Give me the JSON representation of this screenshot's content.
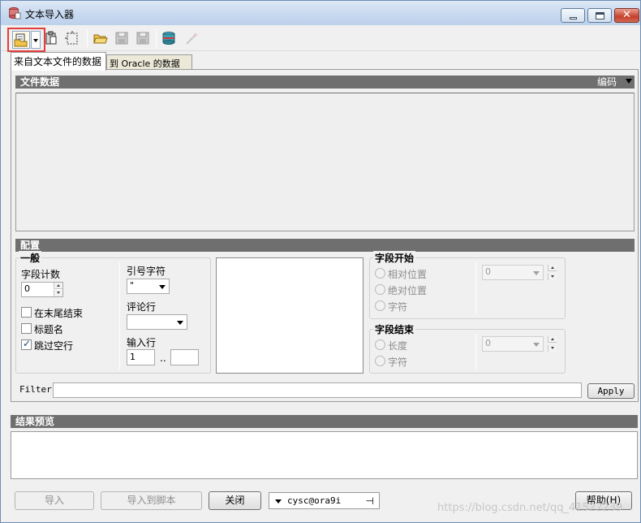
{
  "window": {
    "title": "文本导入器",
    "close_glyph": "✕"
  },
  "toolbar": {
    "icons": [
      "open-file-icon",
      "dropdown-arrow-icon",
      "clipboard-icon",
      "select-region-icon",
      "folder-open-icon",
      "save-icon",
      "save-as-icon",
      "database-icon",
      "magic-wand-icon"
    ]
  },
  "tabs": [
    {
      "label": "来自文本文件的数据",
      "active": true
    },
    {
      "label": "到 Oracle 的数据",
      "active": false
    }
  ],
  "file_data": {
    "header": "文件数据",
    "encoding_label": "编码"
  },
  "config": {
    "header": "配置",
    "general": {
      "label": "一般",
      "field_count_label": "字段计数",
      "field_count_value": "0",
      "end_at_tail": "在末尾结束",
      "header_name": "标题名",
      "skip_empty": "跳过空行",
      "quote_label": "引号字符",
      "quote_value": "\"",
      "comment_label": "评论行",
      "comment_value": "",
      "input_row_label": "输入行",
      "input_row_from": "1",
      "input_row_sep": "..",
      "input_row_to": ""
    },
    "field_start": {
      "label": "字段开始",
      "relative": "相对位置",
      "absolute": "绝对位置",
      "char": "字符",
      "value": "0"
    },
    "field_end": {
      "label": "字段结束",
      "length": "长度",
      "char": "字符",
      "value": "0"
    }
  },
  "filter": {
    "label": "Filter",
    "value": "",
    "apply_label": "Apply"
  },
  "preview": {
    "header": "结果预览"
  },
  "footer": {
    "import_label": "导入",
    "import_script_label": "导入到脚本",
    "close_label": "关闭",
    "connection": "cysc@ora9i",
    "pin_glyph": "⊣",
    "help_label": "帮助(H)"
  },
  "watermark": "https://blog.csdn.net/qq_41522239"
}
